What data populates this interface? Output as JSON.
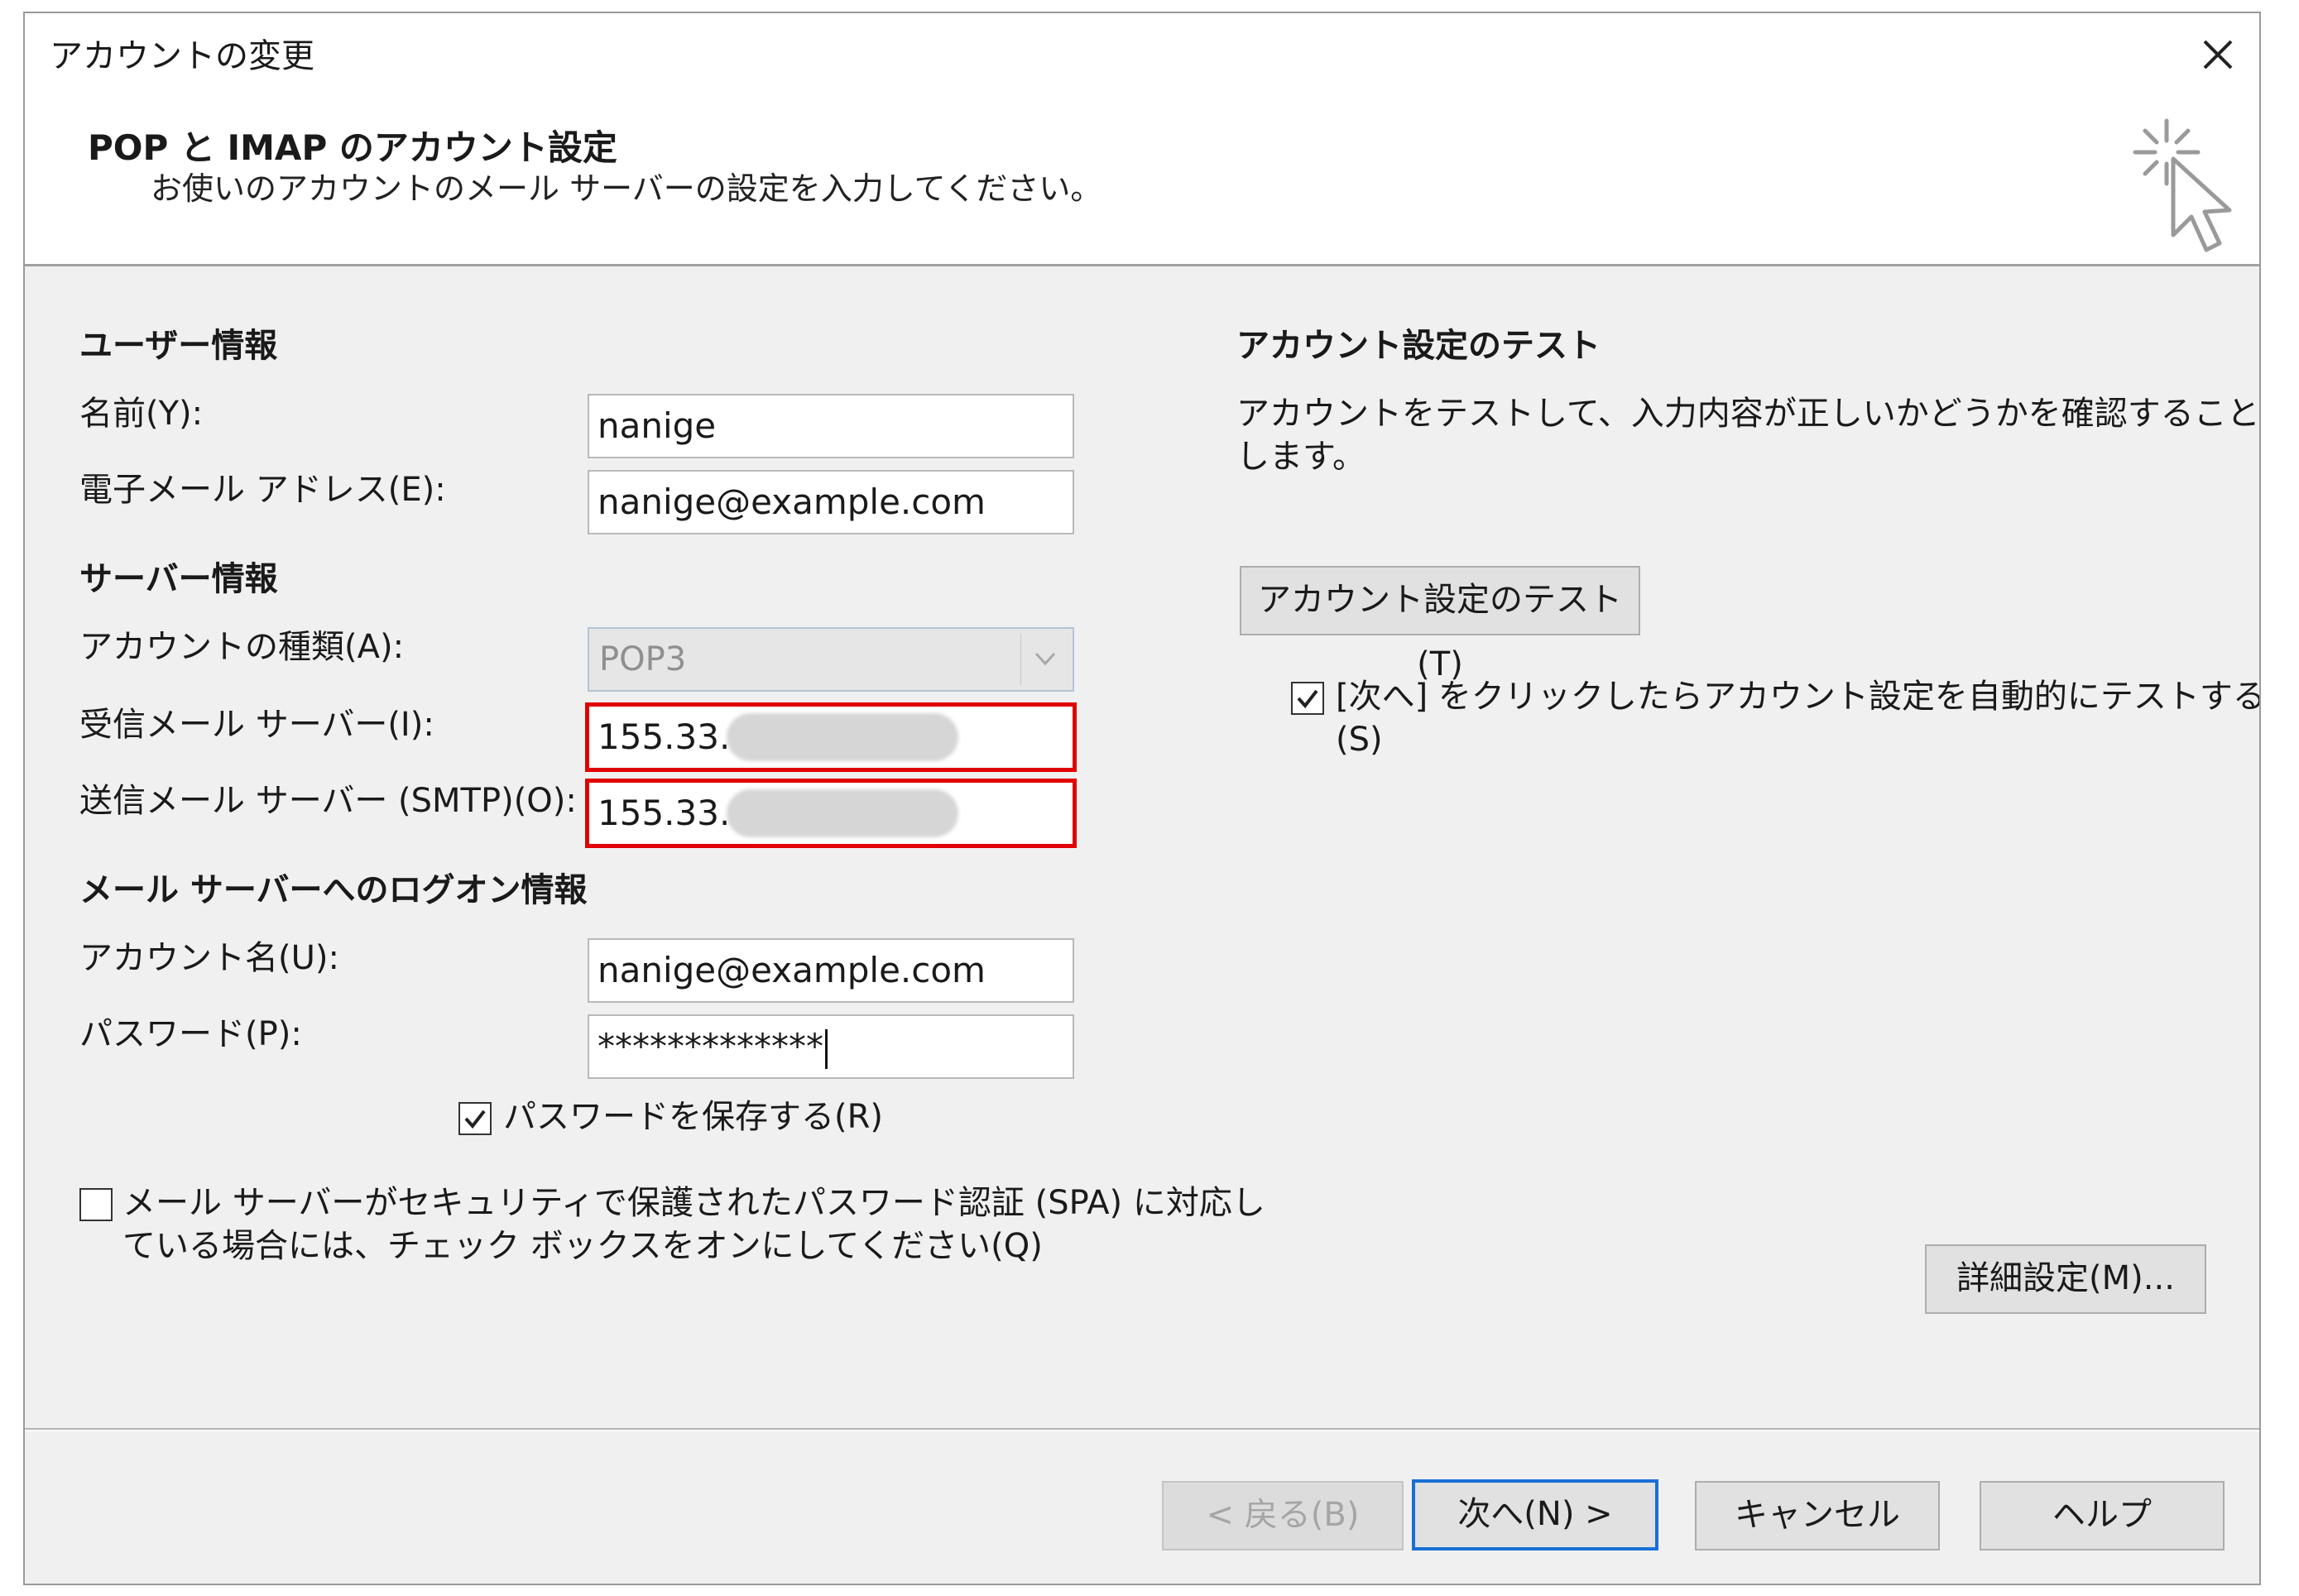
{
  "window": {
    "title": "アカウントの変更",
    "close_icon": "close-icon"
  },
  "header": {
    "title": "POP と IMAP のアカウント設定",
    "subtitle": "お使いのアカウントのメール サーバーの設定を入力してください。",
    "icon": "cursor-sparkle-icon"
  },
  "user_info": {
    "heading": "ユーザー情報",
    "name_label": "名前(Y):",
    "name_value": "nanige",
    "email_label": "電子メール アドレス(E):",
    "email_value": "nanige@example.com"
  },
  "server_info": {
    "heading": "サーバー情報",
    "account_type_label": "アカウントの種類(A):",
    "account_type_value": "POP3",
    "incoming_label": "受信メール サーバー(I):",
    "incoming_value": "155.33.",
    "outgoing_label": "送信メール サーバー (SMTP)(O):",
    "outgoing_value": "155.33."
  },
  "logon_info": {
    "heading": "メール サーバーへのログオン情報",
    "account_name_label": "アカウント名(U):",
    "account_name_value": "nanige@example.com",
    "password_label": "パスワード(P):",
    "password_value": "*************",
    "save_password_label": "パスワードを保存する(R)",
    "save_password_checked": true,
    "spa_label_line1": "メール サーバーがセキュリティで保護されたパスワード認証 (SPA) に対応し",
    "spa_label_line2": "ている場合には、チェック ボックスをオンにしてください(Q)",
    "spa_checked": false
  },
  "test": {
    "heading": "アカウント設定のテスト",
    "description_line1": "アカウントをテストして、入力内容が正しいかどうかを確認することをお勧め",
    "description_line2": "します。",
    "test_button": "アカウント設定のテスト(T)",
    "auto_test_label_line1": "[次へ] をクリックしたらアカウント設定を自動的にテストする",
    "auto_test_label_line2": "(S)",
    "auto_test_checked": true
  },
  "more_settings_button": "詳細設定(M)...",
  "footer": {
    "back": "< 戻る(B)",
    "next": "次へ(N) >",
    "cancel": "キャンセル",
    "help": "ヘルプ"
  },
  "colors": {
    "highlight": "#e00000",
    "primary_border": "#1a6fd6",
    "dialog_bg": "#f0f0f0"
  }
}
